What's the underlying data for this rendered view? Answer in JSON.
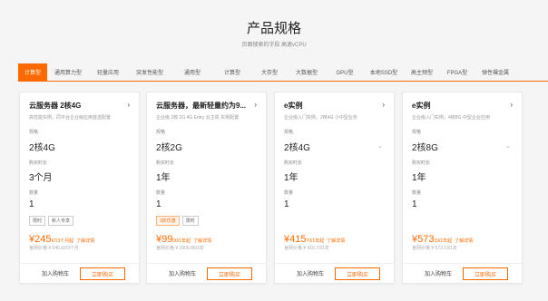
{
  "header": {
    "title": "产品规格",
    "subtitle": "页面搜索的字段 高速vCPU"
  },
  "tabs": [
    {
      "label": "计算型",
      "active": true
    },
    {
      "label": "通用算力型"
    },
    {
      "label": "轻量应用"
    },
    {
      "label": "突发性能型"
    },
    {
      "label": "通用型"
    },
    {
      "label": "计算型"
    },
    {
      "label": "大存型"
    },
    {
      "label": "大数据型"
    },
    {
      "label": "GPU型"
    },
    {
      "label": "本地SSD型"
    },
    {
      "label": "高主频型"
    },
    {
      "label": "FPGA型"
    },
    {
      "label": "弹性裸金属"
    }
  ],
  "labels": {
    "spec": "规格",
    "duration": "购买时长",
    "quantity": "数量",
    "original_price_prefix": "官网价格"
  },
  "cards": [
    {
      "name": "云服务器 2核4G",
      "desc": "高性能实例，同平台企业级应用首选配置",
      "spec": "2核4G",
      "duration": "3个月",
      "quantity": "1",
      "tags": [
        {
          "text": "限时"
        },
        {
          "text": "新人专享"
        }
      ],
      "price": "¥245",
      "price_unit": "97/3个月起",
      "detail": "了解详情",
      "original": "官网价格 ¥ 546.60/3个月"
    },
    {
      "name": "云服务器，最新轻量约为9...",
      "desc": "企业级 2核 2G 4G Entry 云主机  实例配置",
      "spec": "2核2G",
      "duration": "1年",
      "quantity": "1",
      "tags": [
        {
          "text": "3折优惠",
          "orange": true
        },
        {
          "text": "限时"
        }
      ],
      "price": "¥99",
      "price_unit": "00/1年起",
      "detail": "了解详情",
      "original": "官网价格 ¥ 3909.86/1年"
    },
    {
      "name": "e实例",
      "desc": "企业级入门实例，2核4G 小中型业务",
      "spec": "2核4G",
      "duration": "1年",
      "quantity": "1",
      "tags": [],
      "price": "¥415",
      "price_unit": "70/1年起",
      "detail": "了解详情",
      "original": "官网价格 ¥ 415.73/1年"
    },
    {
      "name": "e实例",
      "desc": "企业级入门实例，4核8G 中型企业应用",
      "spec": "2核8G",
      "duration": "1年",
      "quantity": "1",
      "tags": [],
      "price": "¥573",
      "price_unit": "19/1年起",
      "detail": "了解详情",
      "original": "官网价格 ¥ 573.19/1年"
    }
  ],
  "buttons": {
    "add_cart": "加入购物车",
    "buy_now": "立即购买"
  },
  "colors": {
    "accent": "#ff6a00",
    "background": "#f5f5f6"
  }
}
